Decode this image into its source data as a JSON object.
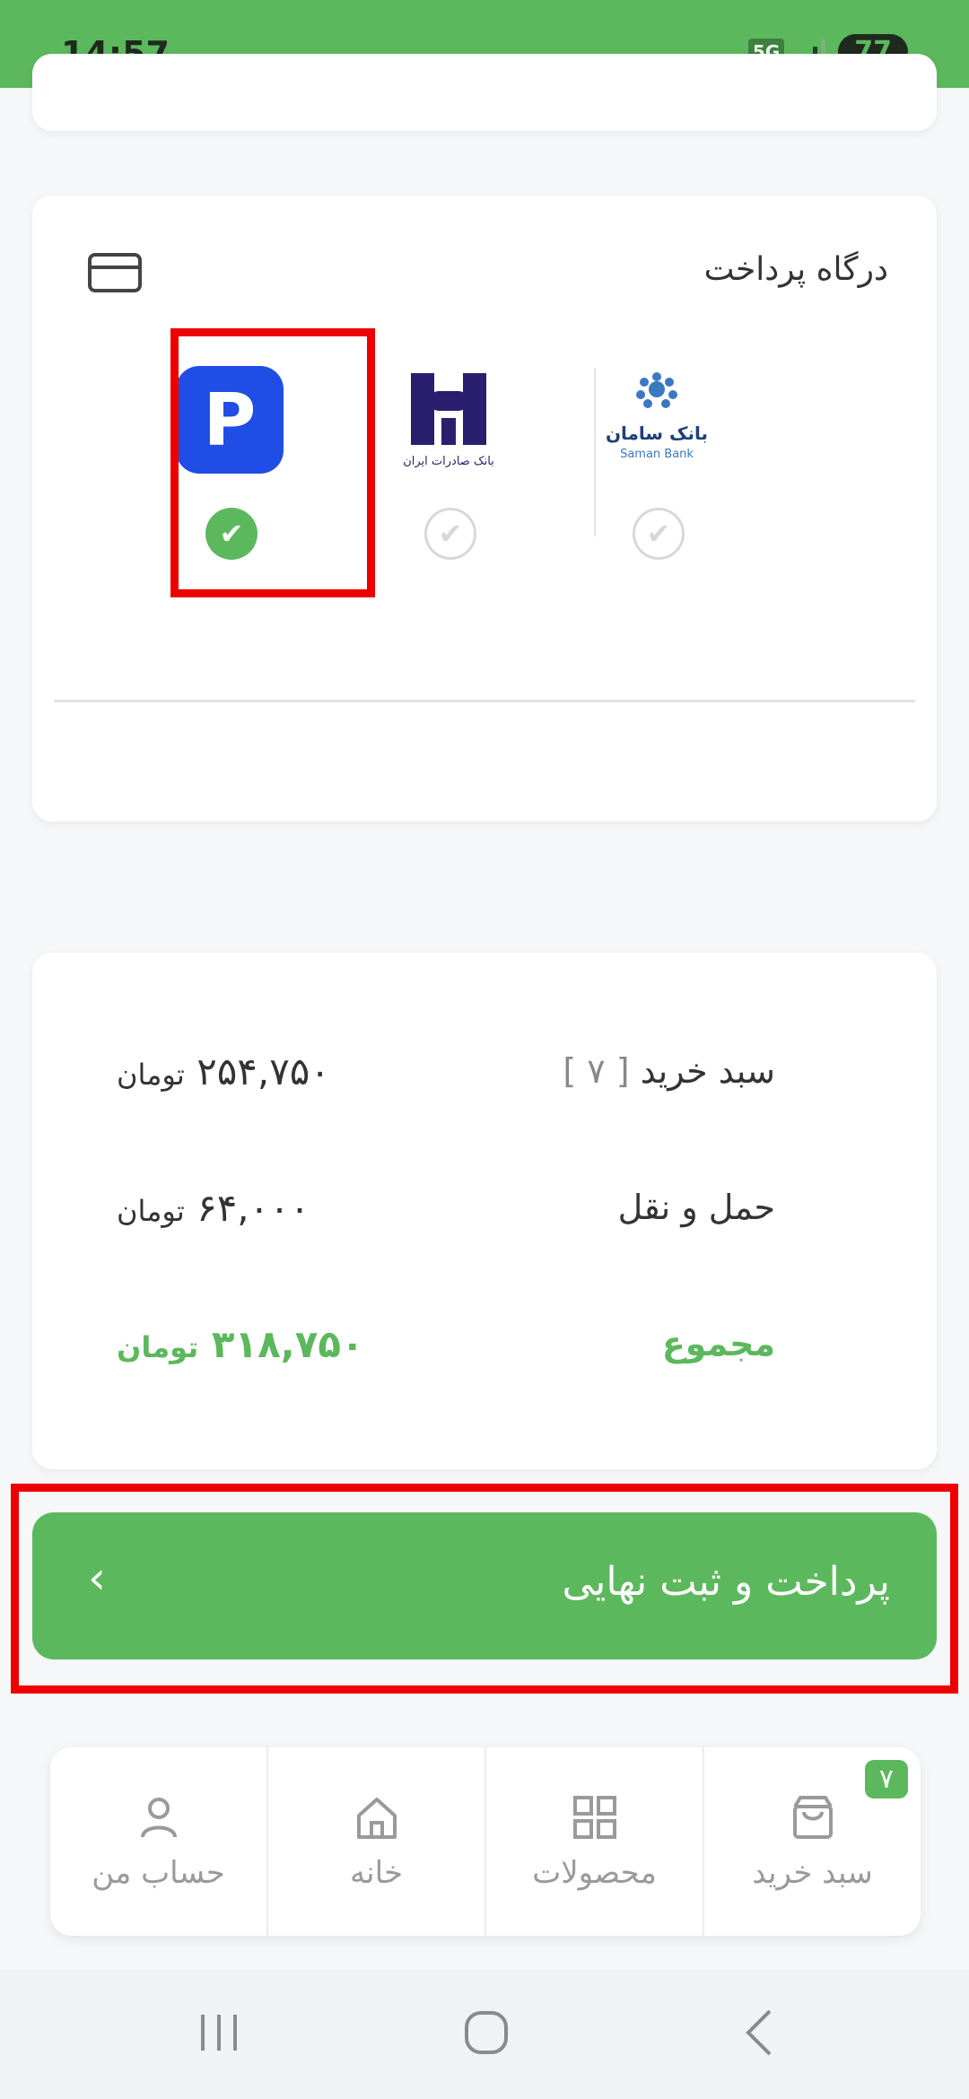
{
  "status_bar": {
    "time": "14:57",
    "network": "5G",
    "battery": "77"
  },
  "gateway": {
    "title": "درگاه پرداخت",
    "options": [
      {
        "name": "Saman Bank",
        "logo_text_fa": "بانک سامان",
        "logo_text_en": "Saman Bank",
        "selected": false
      },
      {
        "name": "Bank Saderat Iran",
        "logo_text_fa": "بانک صادرات ایران",
        "selected": false
      },
      {
        "name": "P payment",
        "logo_letter": "P",
        "selected": true
      }
    ]
  },
  "summary": {
    "cart_label": "سبد خرید",
    "cart_count": "[ ۷ ]",
    "cart_value": "۲۵۴,۷۵۰",
    "shipping_label": "حمل و نقل",
    "shipping_value": "۶۴,۰۰۰",
    "total_label": "مجموع",
    "total_value": "۳۱۸,۷۵۰",
    "currency": "تومان"
  },
  "pay_button": {
    "label": "پرداخت و ثبت نهایی",
    "chevron": "‹"
  },
  "bottom_nav": {
    "items": [
      {
        "label": "حساب من",
        "icon": "user-icon"
      },
      {
        "label": "خانه",
        "icon": "home-icon"
      },
      {
        "label": "محصولات",
        "icon": "grid-icon"
      },
      {
        "label": "سبد خرید",
        "icon": "shopping-bag-icon",
        "badge": "۷"
      }
    ]
  },
  "colors": {
    "accent": "#5cb85c",
    "highlight": "#ee0000"
  }
}
